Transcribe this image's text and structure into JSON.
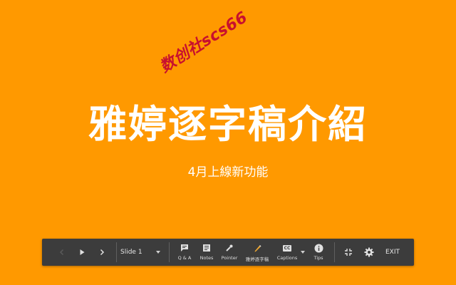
{
  "slide": {
    "title": "雅婷逐字稿介紹",
    "subtitle": "4月上線新功能"
  },
  "watermark": {
    "text": "数创社scs66"
  },
  "toolbar": {
    "prev_icon": "chevron-left-icon",
    "play_icon": "play-icon",
    "next_icon": "chevron-right-icon",
    "slide_select": "Slide 1",
    "tools": [
      {
        "name": "qa",
        "icon": "chat-icon",
        "label": "Q & A"
      },
      {
        "name": "notes",
        "icon": "notes-icon",
        "label": "Notes"
      },
      {
        "name": "pointer",
        "icon": "laser-pointer-icon",
        "label": "Pointer"
      },
      {
        "name": "yating",
        "icon": "pen-icon",
        "label": "雅婷逐字稿"
      },
      {
        "name": "captions",
        "icon": "closed-captions-icon",
        "label": "Captions",
        "badge": "CC"
      },
      {
        "name": "tips",
        "icon": "info-icon",
        "label": "Tips"
      }
    ],
    "exit_label": "EXIT"
  },
  "colors": {
    "background": "#FF9900",
    "toolbar": "#3C3C3C",
    "watermark": "#C8102E",
    "text": "#FFFFFF"
  }
}
